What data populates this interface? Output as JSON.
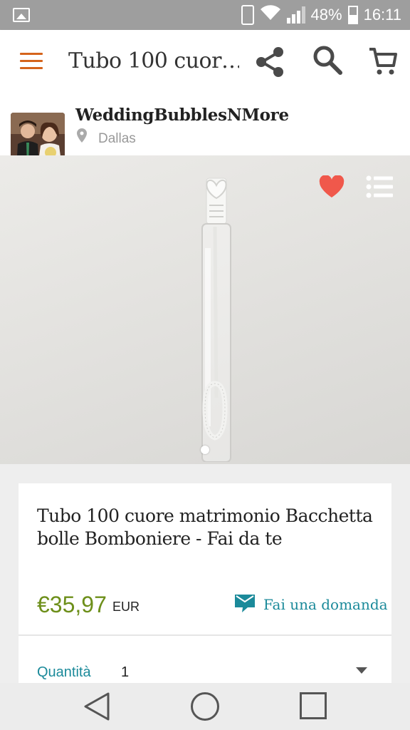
{
  "status_bar": {
    "battery": "48%",
    "time": "16:11",
    "icons": [
      "gallery-icon",
      "vibrate-icon",
      "wifi-icon",
      "signal-icon",
      "battery-icon"
    ]
  },
  "app_bar": {
    "title": "Tubo 100 cuor…",
    "icons": [
      "menu-icon",
      "share-icon",
      "search-icon",
      "cart-icon"
    ],
    "accent": "#d5641c"
  },
  "seller": {
    "name": "WeddingBubblesNMore",
    "location": "Dallas"
  },
  "product": {
    "title": "Tubo 100 cuore matrimonio Bacchetta bolle Bomboniere - Fai da te",
    "price": "€35,97",
    "currency": "EUR",
    "ask_label": "Fai una domanda",
    "favorite_color": "#f0584b",
    "price_color": "#6d8f1a",
    "link_color": "#1b8a9a"
  },
  "quantity": {
    "label": "Quantità",
    "value": "1"
  },
  "nav_bar": {
    "icons": [
      "back-icon",
      "home-icon",
      "recent-apps-icon"
    ]
  }
}
